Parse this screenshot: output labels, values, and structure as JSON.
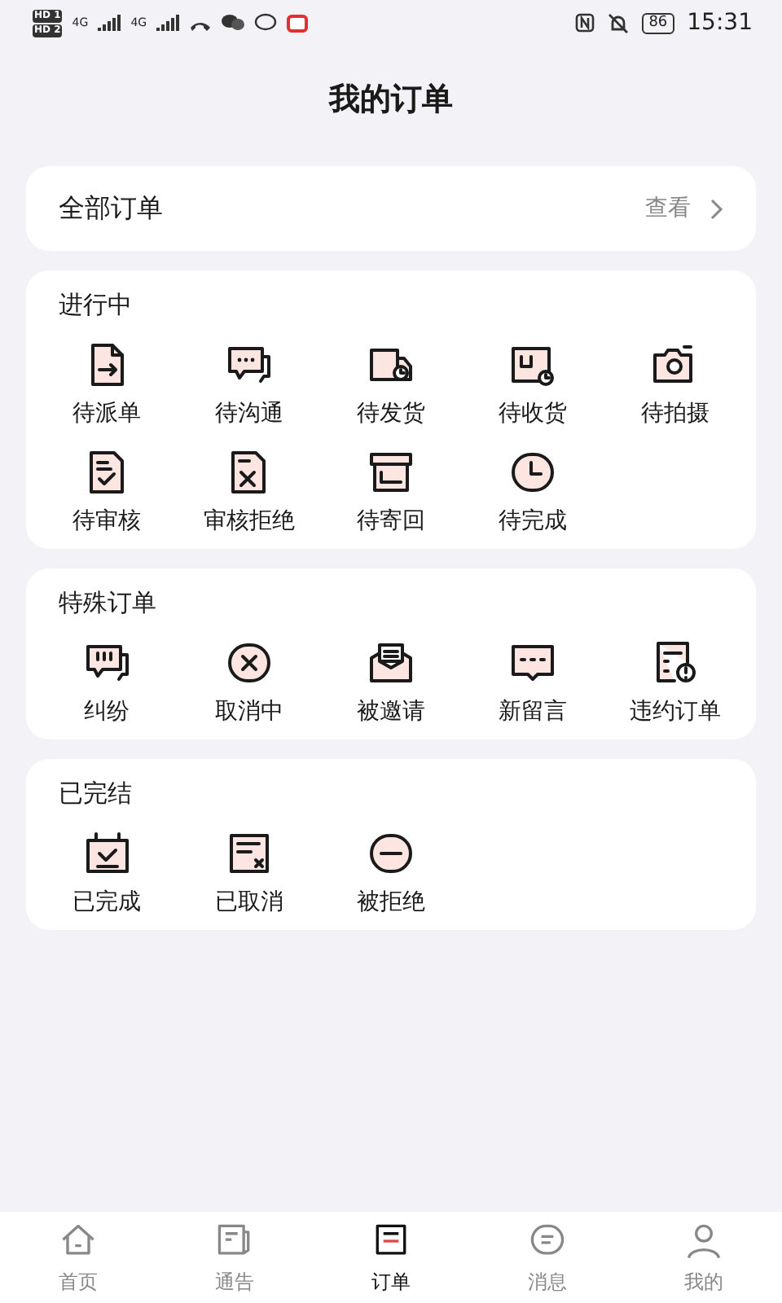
{
  "status_bar": {
    "sims": [
      {
        "badge": "HD",
        "slot": "1",
        "net": "4G"
      },
      {
        "badge": "HD",
        "slot": "2",
        "net": "4G"
      }
    ],
    "battery": "86",
    "time": "15:31"
  },
  "header": {
    "title": "我的订单"
  },
  "all_orders": {
    "label": "全部订单",
    "action": "查看"
  },
  "sections": [
    {
      "title": "进行中",
      "items": [
        {
          "label": "待派单"
        },
        {
          "label": "待沟通"
        },
        {
          "label": "待发货"
        },
        {
          "label": "待收货"
        },
        {
          "label": "待拍摄"
        },
        {
          "label": "待审核"
        },
        {
          "label": "审核拒绝"
        },
        {
          "label": "待寄回"
        },
        {
          "label": "待完成"
        }
      ]
    },
    {
      "title": "特殊订单",
      "items": [
        {
          "label": "纠纷"
        },
        {
          "label": "取消中"
        },
        {
          "label": "被邀请"
        },
        {
          "label": "新留言"
        },
        {
          "label": "违约订单"
        }
      ]
    },
    {
      "title": "已完结",
      "items": [
        {
          "label": "已完成"
        },
        {
          "label": "已取消"
        },
        {
          "label": "被拒绝"
        }
      ]
    }
  ],
  "tab_bar": [
    {
      "label": "首页",
      "selected": false
    },
    {
      "label": "通告",
      "selected": false
    },
    {
      "label": "订单",
      "selected": true
    },
    {
      "label": "消息",
      "selected": false
    },
    {
      "label": "我的",
      "selected": false
    }
  ]
}
